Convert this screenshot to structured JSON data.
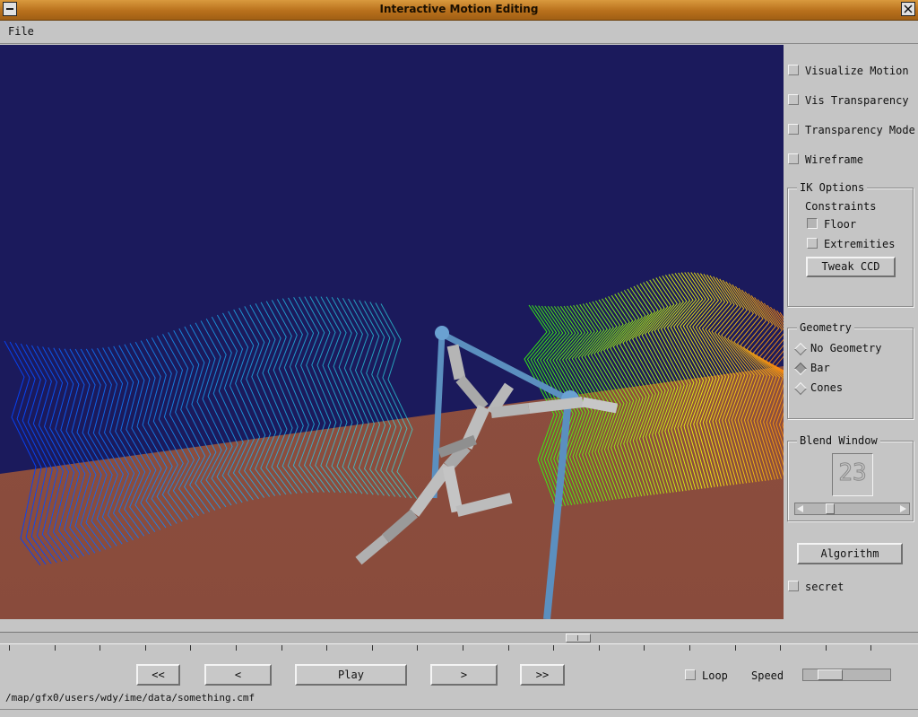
{
  "window": {
    "title": "Interactive Motion Editing"
  },
  "menu": {
    "file": "File"
  },
  "panel": {
    "visualize_motion": "Visualize Motion",
    "vis_transparency": "Vis Transparency",
    "transparency_mode": "Transparency Mode",
    "wireframe": "Wireframe",
    "ik_options": {
      "title": "IK Options",
      "constraints": "Constraints",
      "floor": "Floor",
      "extremities": "Extremities",
      "tweak_ccd": "Tweak CCD"
    },
    "geometry": {
      "title": "Geometry",
      "options": [
        "No Geometry",
        "Bar",
        "Cones"
      ],
      "selected": "Bar"
    },
    "blend_window": {
      "title": "Blend Window",
      "value": "23"
    },
    "algorithm": "Algorithm",
    "secret": "secret"
  },
  "transport": {
    "rewind": "<<",
    "prev": "<",
    "play": "Play",
    "next": ">",
    "fast_forward": ">>",
    "loop": "Loop",
    "speed": "Speed"
  },
  "status": {
    "path": "/map/gfx0/users/wdy/ime/data/something.cmf"
  },
  "colors": {
    "sky": "#1b1a5c",
    "floor": "#8c4e3e",
    "bar": "#5b92c4",
    "figure": "#b4b4b4",
    "title_bar": "#c58a35"
  }
}
